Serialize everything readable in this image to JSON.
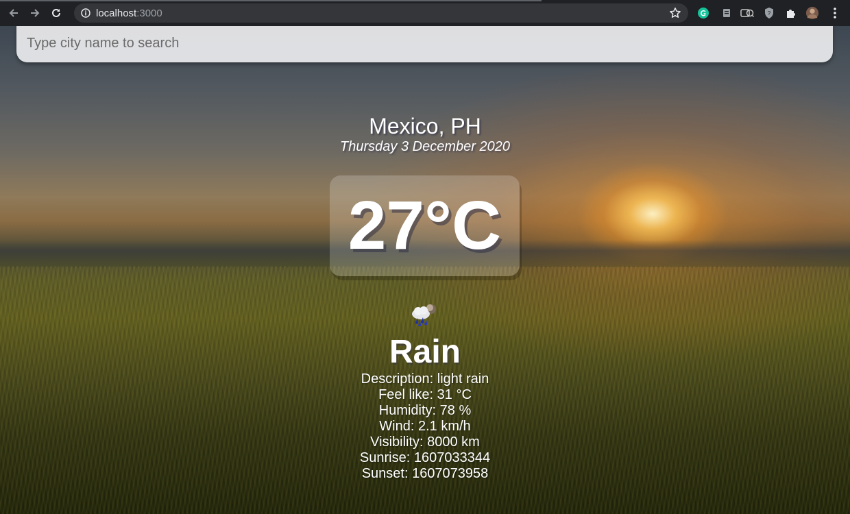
{
  "browser": {
    "url_host": "localhost",
    "url_port": ":3000"
  },
  "search": {
    "placeholder": "Type city name to search",
    "value": ""
  },
  "weather": {
    "location": "Mexico, PH",
    "date": "Thursday 3 December 2020",
    "temperature": "27°C",
    "icon": "rain-cloud-icon",
    "condition": "Rain",
    "details": {
      "description": "Description: light rain",
      "feels_like": "Feel like: 31 °C",
      "humidity": "Humidity: 78 %",
      "wind": "Wind: 2.1 km/h",
      "visibility": "Visibility: 8000 km",
      "sunrise": "Sunrise: 1607033344",
      "sunset": "Sunset: 1607073958"
    }
  },
  "colors": {
    "chrome_bg": "#202124",
    "omnibox_bg": "#35363a",
    "grammarly": "#15c39a",
    "text_white": "#ffffff"
  }
}
